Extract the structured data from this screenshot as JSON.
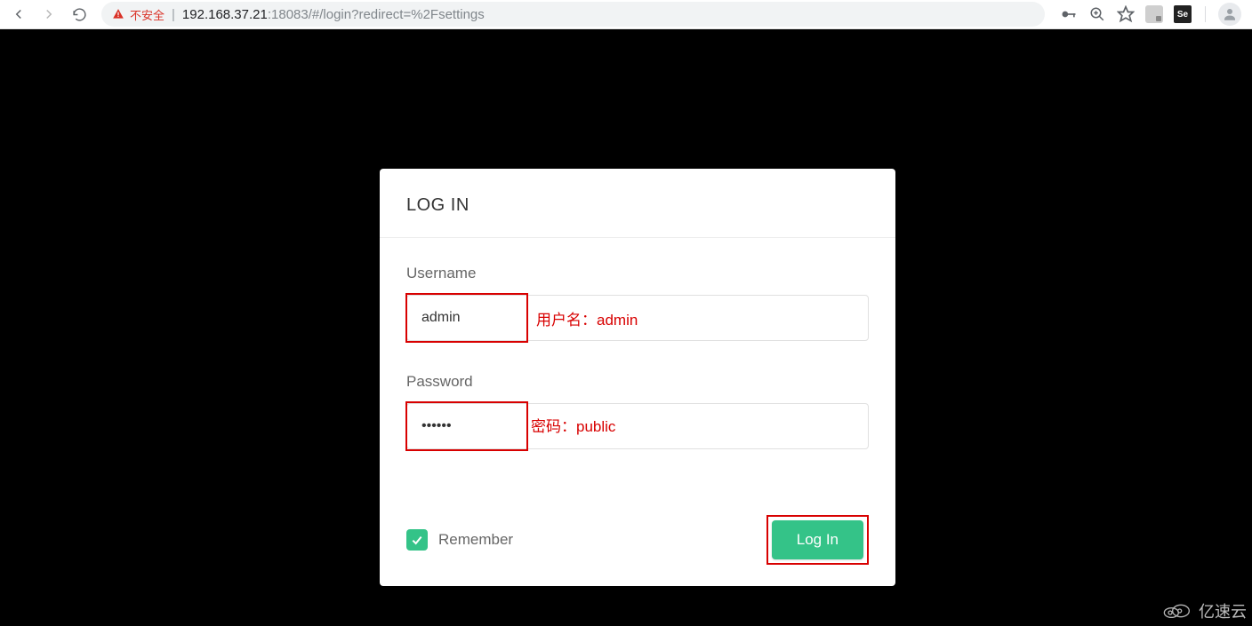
{
  "browser": {
    "security_warning": "不安全",
    "url_host": "192.168.37.21",
    "url_rest": ":18083/#/login?redirect=%2Fsettings",
    "icons": {
      "key": "⚿",
      "zoom": "⊕",
      "star": "☆",
      "selenium_badge": "Se"
    }
  },
  "login": {
    "title": "LOG IN",
    "username_label": "Username",
    "username_value": "admin",
    "password_label": "Password",
    "password_value": "••••••",
    "remember_label": "Remember",
    "remember_checked": true,
    "submit_label": "Log In"
  },
  "annotations": {
    "username_note": "用户名：admin",
    "password_note": "密码：public"
  },
  "watermark": "亿速云"
}
